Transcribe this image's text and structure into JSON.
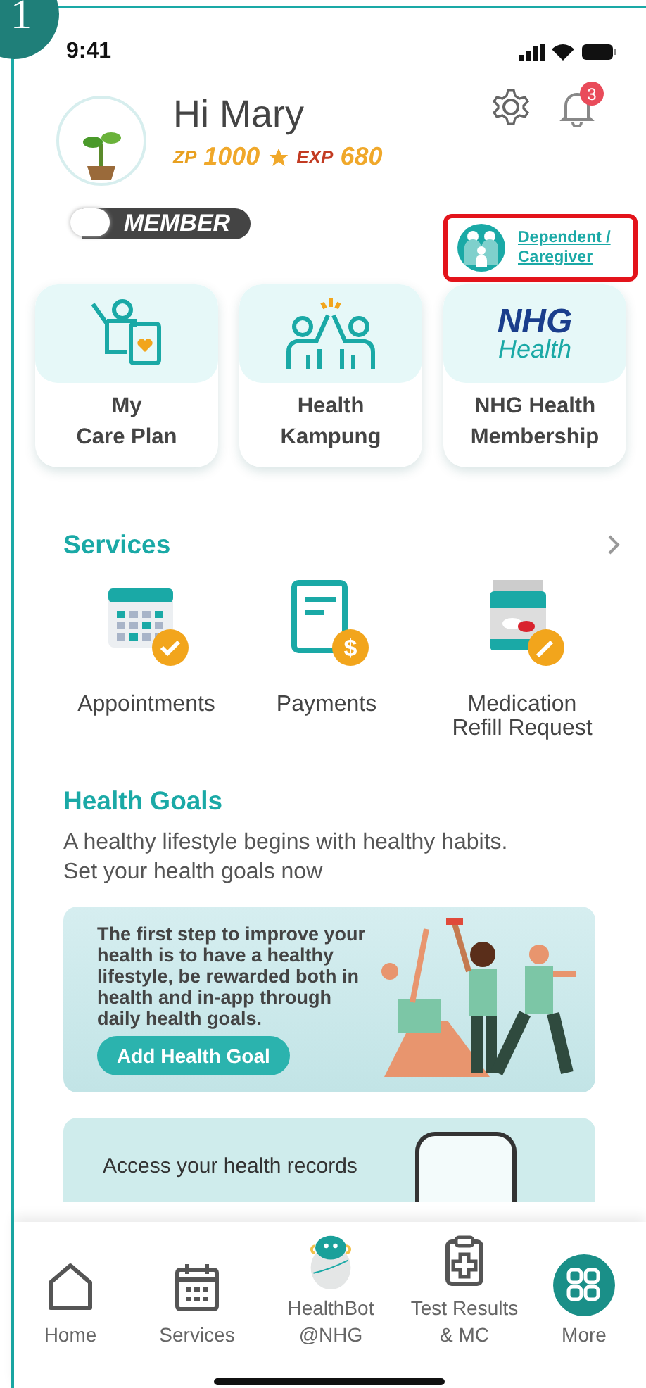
{
  "annotation": {
    "step": "1"
  },
  "status_bar": {
    "time": "9:41"
  },
  "profile": {
    "greeting": "Hi Mary",
    "zp_label": "ZP",
    "zp": "1000",
    "exp_label": "EXP",
    "exp": "680",
    "badge": "MEMBER",
    "notification_count": "3"
  },
  "dependent_link": {
    "label": "Dependent /\nCaregiver",
    "highlighted": true
  },
  "quick_cards": [
    {
      "kind": "care-plan",
      "label": "My\nCare Plan"
    },
    {
      "kind": "kampung",
      "label": "Health\nKampung"
    },
    {
      "kind": "membership",
      "logo_top": "NHG",
      "logo_bottom": "Health",
      "label": "NHG Health\nMembership"
    }
  ],
  "services": {
    "title": "Services",
    "items": [
      {
        "kind": "appointments",
        "label": "Appointments"
      },
      {
        "kind": "payments",
        "symbol": "$",
        "label": "Payments"
      },
      {
        "kind": "refill",
        "label": "Medication\nRefill Request"
      }
    ]
  },
  "health_goals": {
    "title": "Health Goals",
    "description": "A healthy lifestyle begins with healthy habits.\nSet your health goals now",
    "banner_text": "The first step to improve your health is to have a healthy lifestyle, be rewarded both in health and in-app through daily health goals.",
    "button": "Add Health Goal"
  },
  "records_banner": {
    "text": "Access your health records"
  },
  "nav": [
    {
      "kind": "home",
      "label": "Home",
      "selected": false
    },
    {
      "kind": "services",
      "label": "Services",
      "selected": false
    },
    {
      "kind": "bot",
      "label": "HealthBot\n@NHG",
      "selected": false
    },
    {
      "kind": "results",
      "label": "Test Results\n& MC",
      "selected": false
    },
    {
      "kind": "more",
      "label": "More",
      "selected": true
    }
  ]
}
